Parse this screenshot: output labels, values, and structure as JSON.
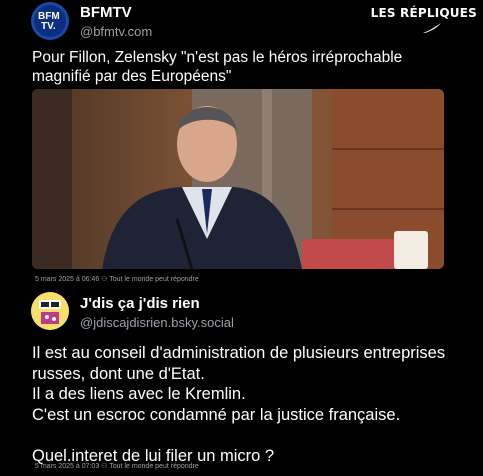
{
  "brand": {
    "label": "LES RÉPLIQUES"
  },
  "post1": {
    "author": "BFMTV",
    "handle": "@bfmtv.com",
    "avatar_text_top": "BFM",
    "avatar_text_bottom": "TV.",
    "text": "Pour Fillon, Zelensky \"n'est pas le héros irréprochable magnifié par des Européens\"",
    "meta": "5 mars 2025 à 06:46  ⚇ Tout le monde peut répondre"
  },
  "post2": {
    "author": "J'dis ça j'dis rien",
    "handle": "@jdiscajdisrien.bsky.social",
    "lines": [
      "Il est au conseil d'administration de plusieurs entreprises",
      "russes, dont une d'Etat.",
      "Il a des liens avec le Kremlin.",
      "C'est un escroc condamné par la justice française.",
      "",
      "Quel.interet de lui filer un micro ?"
    ],
    "meta": "5 mars 2025 à 07:03  ⚇ Tout le monde peut répondre"
  },
  "colors": {
    "background": "#000000",
    "text": "#ffffff",
    "muted": "#9aa1a9",
    "bfm_blue": "#0b2f7e",
    "jdis_yellow": "#f6e06a"
  },
  "icons": {
    "brand": "quill-icon",
    "reply": "people-icon"
  }
}
